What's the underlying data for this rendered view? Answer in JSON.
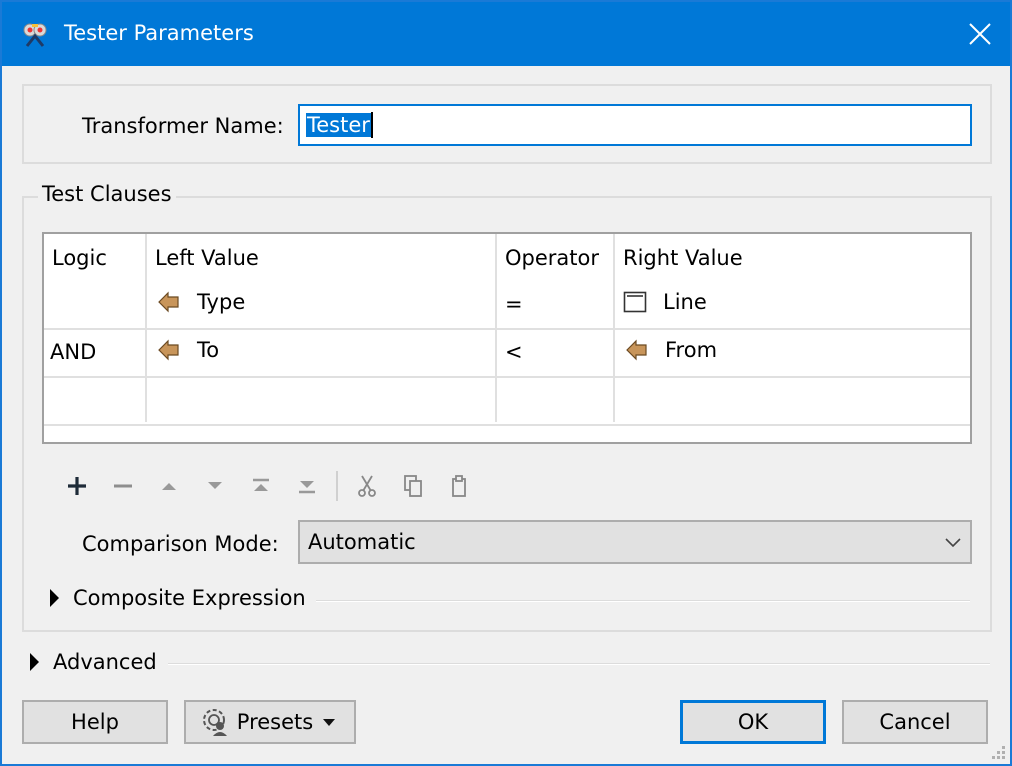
{
  "window": {
    "title": "Tester Parameters",
    "icons": {
      "app": "tester-transformer-icon",
      "close": "close-icon"
    }
  },
  "transformer_name": {
    "label": "Transformer Name:",
    "value": "Tester",
    "selected": true
  },
  "test_clauses": {
    "title": "Test Clauses",
    "columns": [
      "Logic",
      "Left Value",
      "Operator",
      "Right Value"
    ],
    "rows": [
      {
        "logic": "",
        "left": {
          "icon": "attribute-icon",
          "text": "Type"
        },
        "operator": "=",
        "right": {
          "icon": "constant-value-icon",
          "text": "Line"
        }
      },
      {
        "logic": "AND",
        "left": {
          "icon": "attribute-icon",
          "text": "To"
        },
        "operator": "<",
        "right": {
          "icon": "attribute-icon",
          "text": "From"
        }
      },
      {
        "logic": "",
        "left": {
          "icon": "",
          "text": ""
        },
        "operator": "",
        "right": {
          "icon": "",
          "text": ""
        }
      }
    ],
    "toolbar": [
      {
        "name": "add-row-button",
        "icon": "plus-icon",
        "enabled": true
      },
      {
        "name": "remove-row-button",
        "icon": "minus-icon",
        "enabled": false
      },
      {
        "name": "move-up-button",
        "icon": "triangle-up-icon",
        "enabled": false
      },
      {
        "name": "move-down-button",
        "icon": "triangle-down-icon",
        "enabled": false
      },
      {
        "name": "move-top-button",
        "icon": "move-to-top-icon",
        "enabled": false
      },
      {
        "name": "move-bottom-button",
        "icon": "move-to-bottom-icon",
        "enabled": false
      },
      {
        "name": "cut-button",
        "icon": "scissors-icon",
        "enabled": false
      },
      {
        "name": "copy-button",
        "icon": "copy-icon",
        "enabled": false
      },
      {
        "name": "paste-button",
        "icon": "clipboard-icon",
        "enabled": false
      }
    ],
    "comparison_mode": {
      "label": "Comparison Mode:",
      "value": "Automatic"
    },
    "composite_expression": {
      "label": "Composite Expression",
      "expanded": false
    }
  },
  "advanced": {
    "label": "Advanced",
    "expanded": false
  },
  "buttons": {
    "help": "Help",
    "presets": "Presets",
    "ok": "OK",
    "cancel": "Cancel"
  },
  "colors": {
    "accent": "#0078d7",
    "attribute_icon": "#c8955a"
  }
}
